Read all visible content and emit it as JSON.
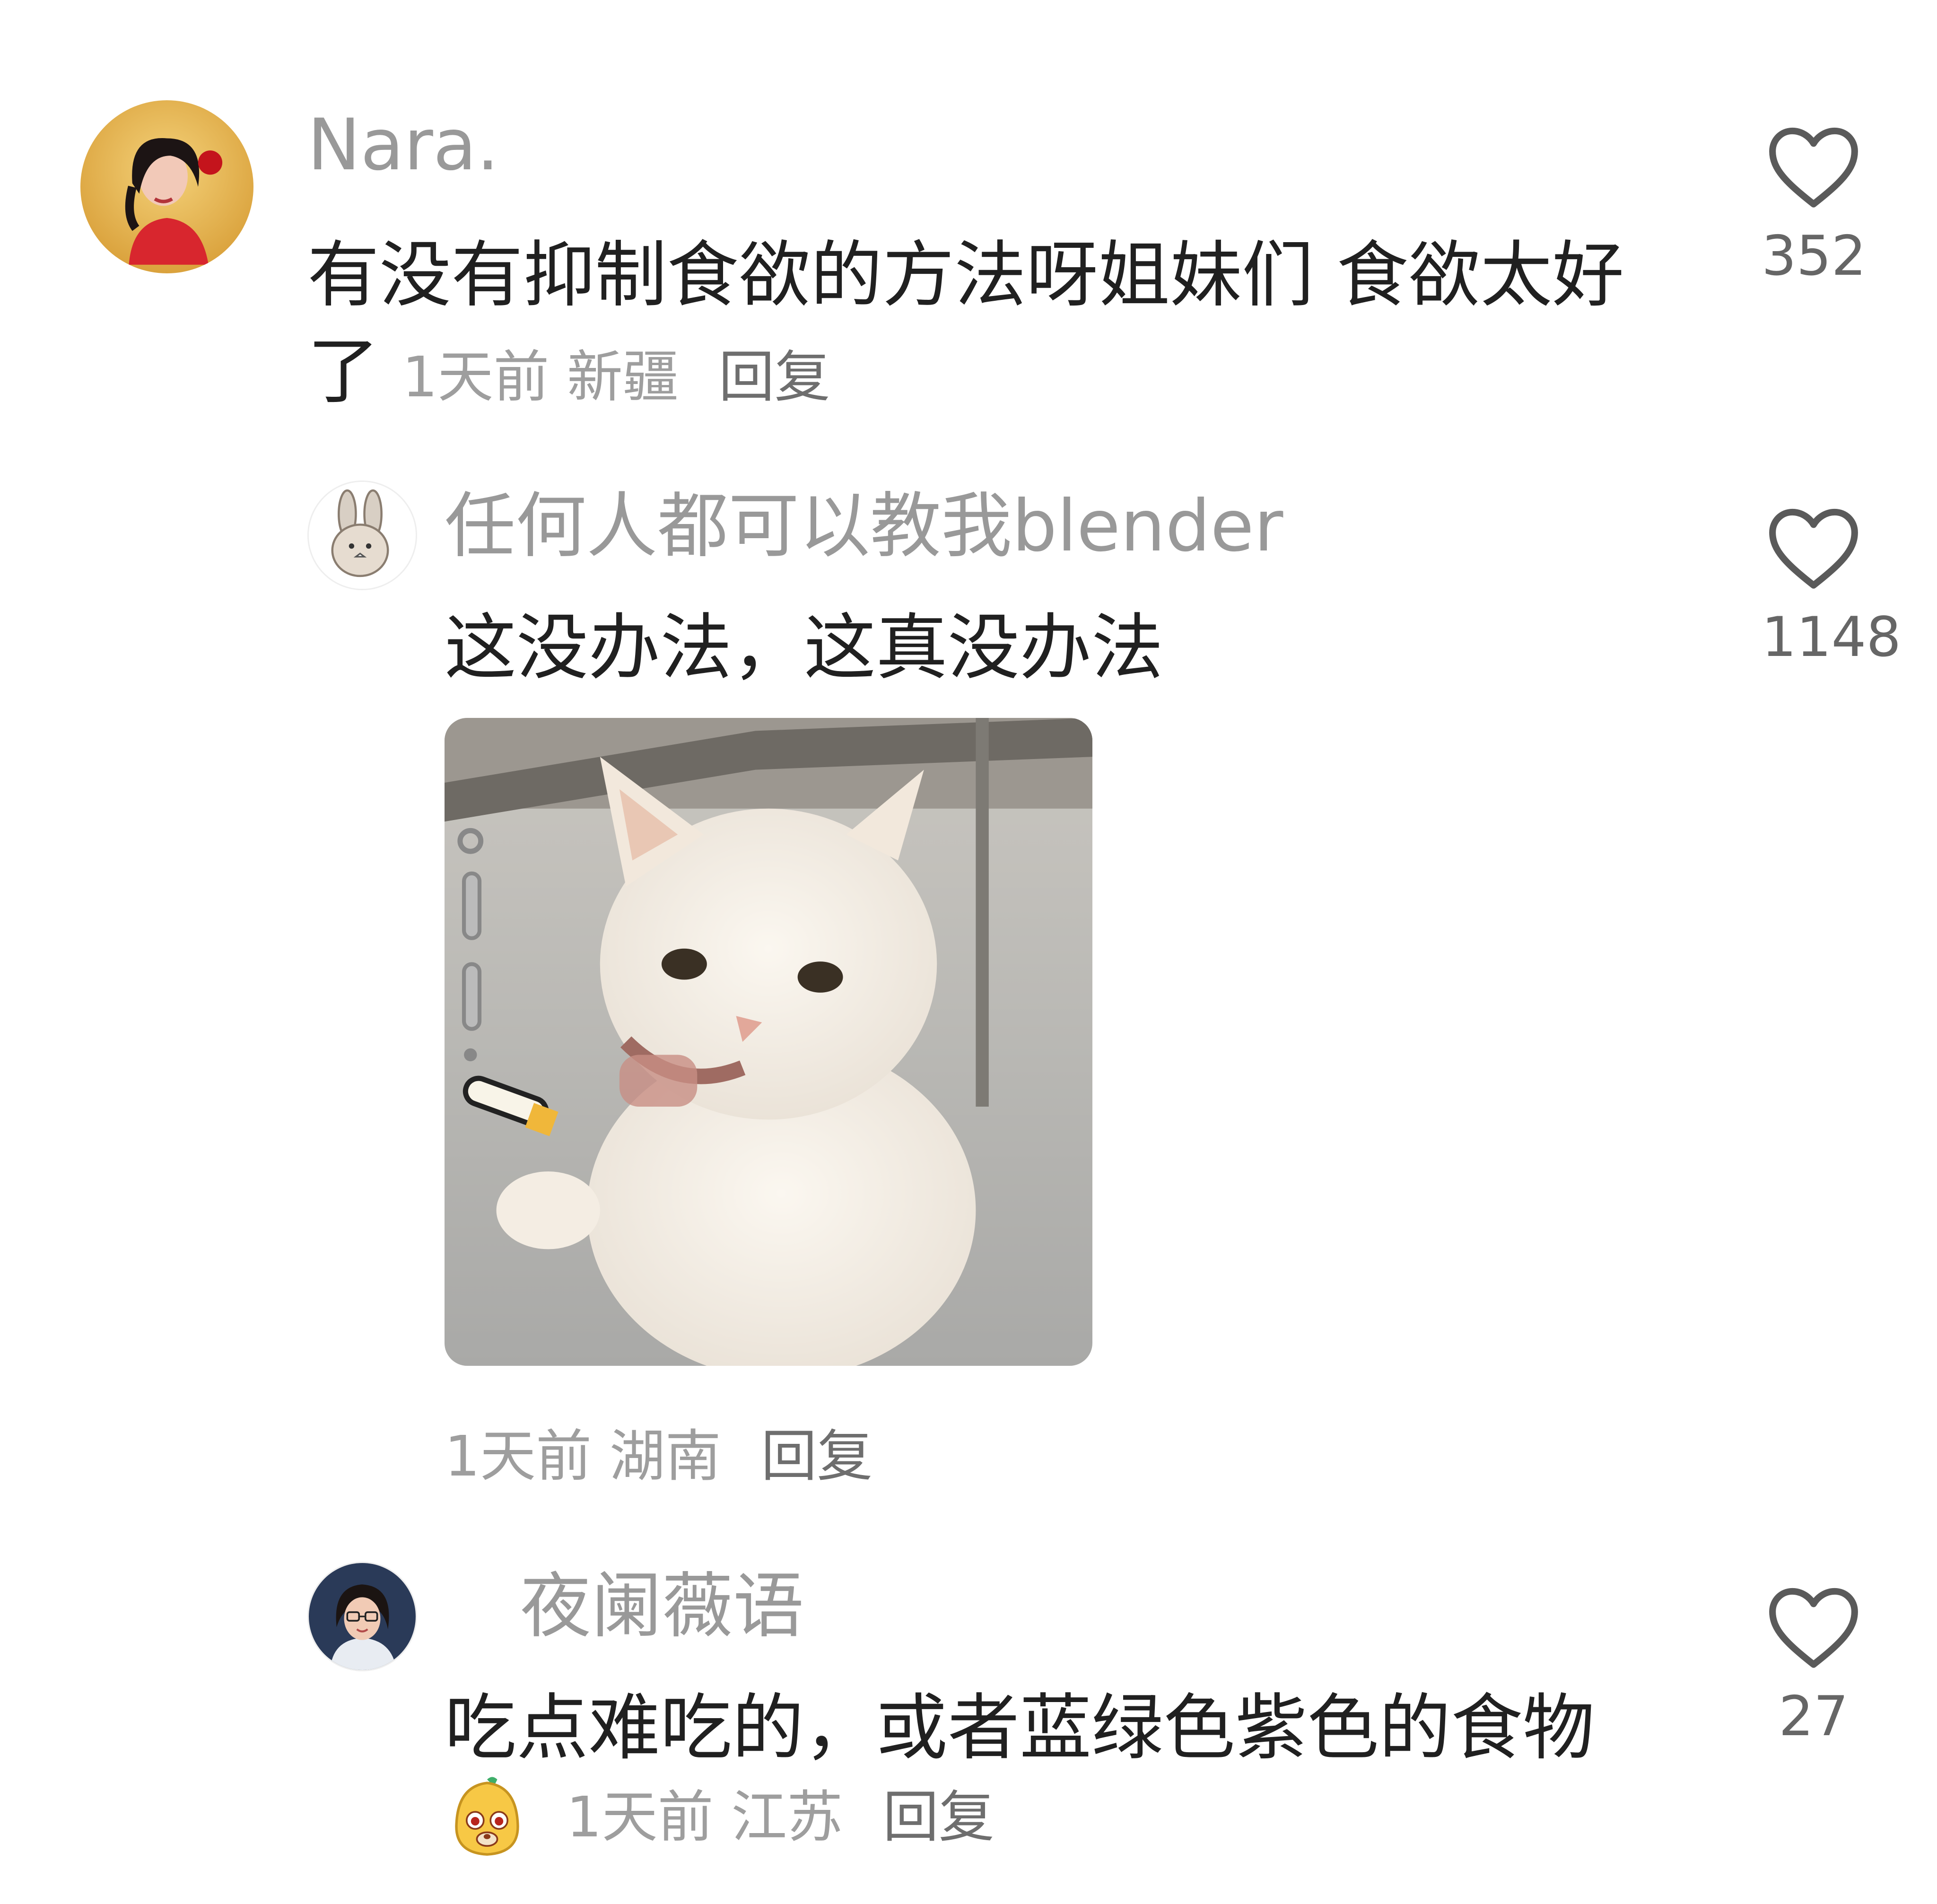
{
  "comments": [
    {
      "username": "Nara.",
      "text": "有没有抑制食欲的方法呀姐妹们 食欲太好了",
      "time": "1天前",
      "location": "新疆",
      "reply_label": "回复",
      "likes": "352"
    },
    {
      "username": "任何人都可以教我blender",
      "text": "这没办法，这真没办法",
      "time": "1天前",
      "location": "湖南",
      "reply_label": "回复",
      "likes": "1148"
    },
    {
      "username": "夜阑薇语",
      "text": "吃点难吃的，或者蓝绿色紫色的食物",
      "time": "1天前",
      "location": "江苏",
      "reply_label": "回复",
      "likes": "27"
    }
  ],
  "icons": {
    "like": "heart-outline-icon",
    "emoji": "mascot-sticker-icon"
  },
  "colors": {
    "username": "#999999",
    "text": "#202020",
    "meta": "#9e9e9e",
    "reply": "#6e6e6e",
    "heart": "#5a5a5a"
  }
}
